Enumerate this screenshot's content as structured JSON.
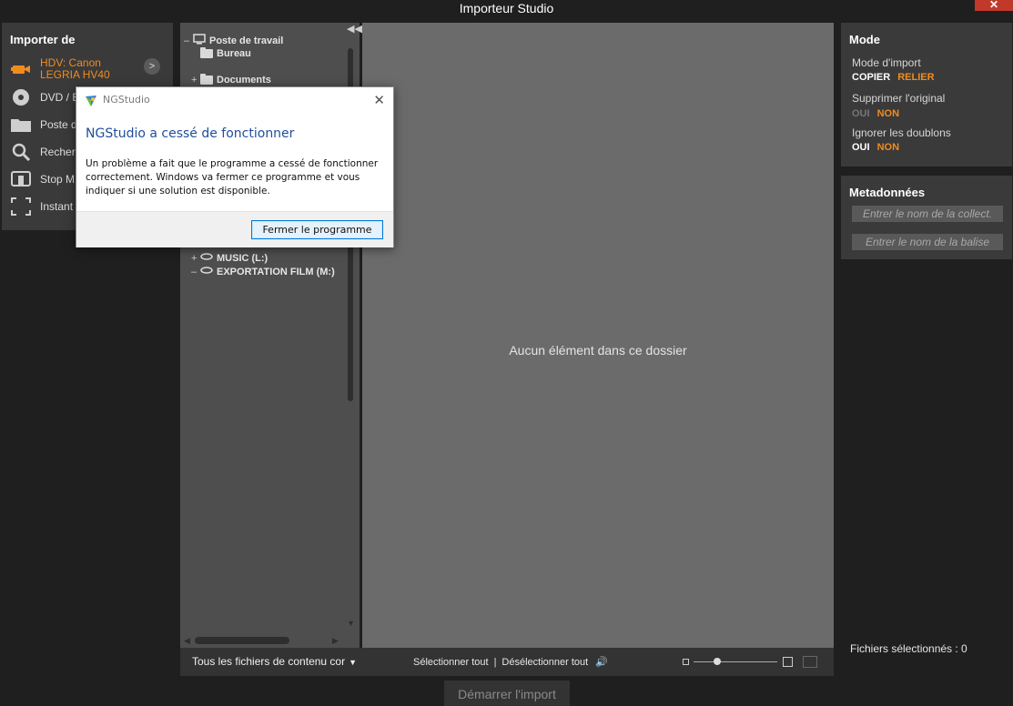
{
  "window": {
    "title": "Importeur Studio",
    "close_glyph": "✕"
  },
  "import_from": {
    "heading": "Importer de",
    "items": [
      {
        "label_line1": "HDV: Canon",
        "label_line2": "LEGRIA HV40",
        "icon": "camcorder-icon",
        "active": true
      },
      {
        "label_line1": "DVD / B",
        "label_line2": "",
        "icon": "disc-icon"
      },
      {
        "label_line1": "Poste d",
        "label_line2": "",
        "icon": "folder-icon"
      },
      {
        "label_line1": "Recher",
        "label_line2": "",
        "icon": "search-icon"
      },
      {
        "label_line1": "Stop M",
        "label_line2": "",
        "icon": "stop-motion-icon"
      },
      {
        "label_line1": "Instant",
        "label_line2": "",
        "icon": "snapshot-icon"
      }
    ],
    "arrow_glyph": ">"
  },
  "tree": {
    "items": [
      {
        "toggle": "–",
        "label": "Poste de travail",
        "icon": "computer-icon"
      },
      {
        "toggle": "",
        "label": "Bureau",
        "icon": "folder-icon"
      },
      {
        "toggle": "+",
        "label": "Documents",
        "icon": "folder-icon"
      },
      {
        "toggle": "+",
        "label": "MUSIC (L:)",
        "icon": "drive-icon"
      },
      {
        "toggle": "–",
        "label": "EXPORTATION FILM (M:)",
        "icon": "drive-icon"
      }
    ]
  },
  "content": {
    "empty_message": "Aucun élément dans ce dossier"
  },
  "bottom": {
    "filter": "Tous les fichiers de contenu cor",
    "select_all": "Sélectionner tout",
    "separator": "|",
    "deselect_all": "Désélectionner tout"
  },
  "start_button": "Démarrer l'import",
  "mode": {
    "heading": "Mode",
    "import_mode_label": "Mode d'import",
    "import_mode_opts": [
      "COPIER",
      "RELIER"
    ],
    "delete_original_label": "Supprimer l'original",
    "delete_original_opts": [
      "OUI",
      "NON"
    ],
    "ignore_dupes_label": "Ignorer les doublons",
    "ignore_dupes_opts": [
      "OUI",
      "NON"
    ]
  },
  "metadata": {
    "heading": "Metadonnées",
    "collection_placeholder": "Entrer le nom de la collect.",
    "tag_placeholder": "Entrer le nom de la balise"
  },
  "files_selected": "Fichiers sélectionnés : 0",
  "dialog": {
    "app_title": "NGStudio",
    "heading": "NGStudio a cessé de fonctionner",
    "message": "Un problème a fait que le programme a cessé de fonctionner correctement. Windows va fermer ce programme et vous indiquer si une solution est disponible.",
    "button": "Fermer le programme",
    "close_glyph": "✕"
  },
  "colors": {
    "accent": "#f08c1f",
    "dialog_heading": "#1f4e9c",
    "button_border": "#0078d7"
  }
}
